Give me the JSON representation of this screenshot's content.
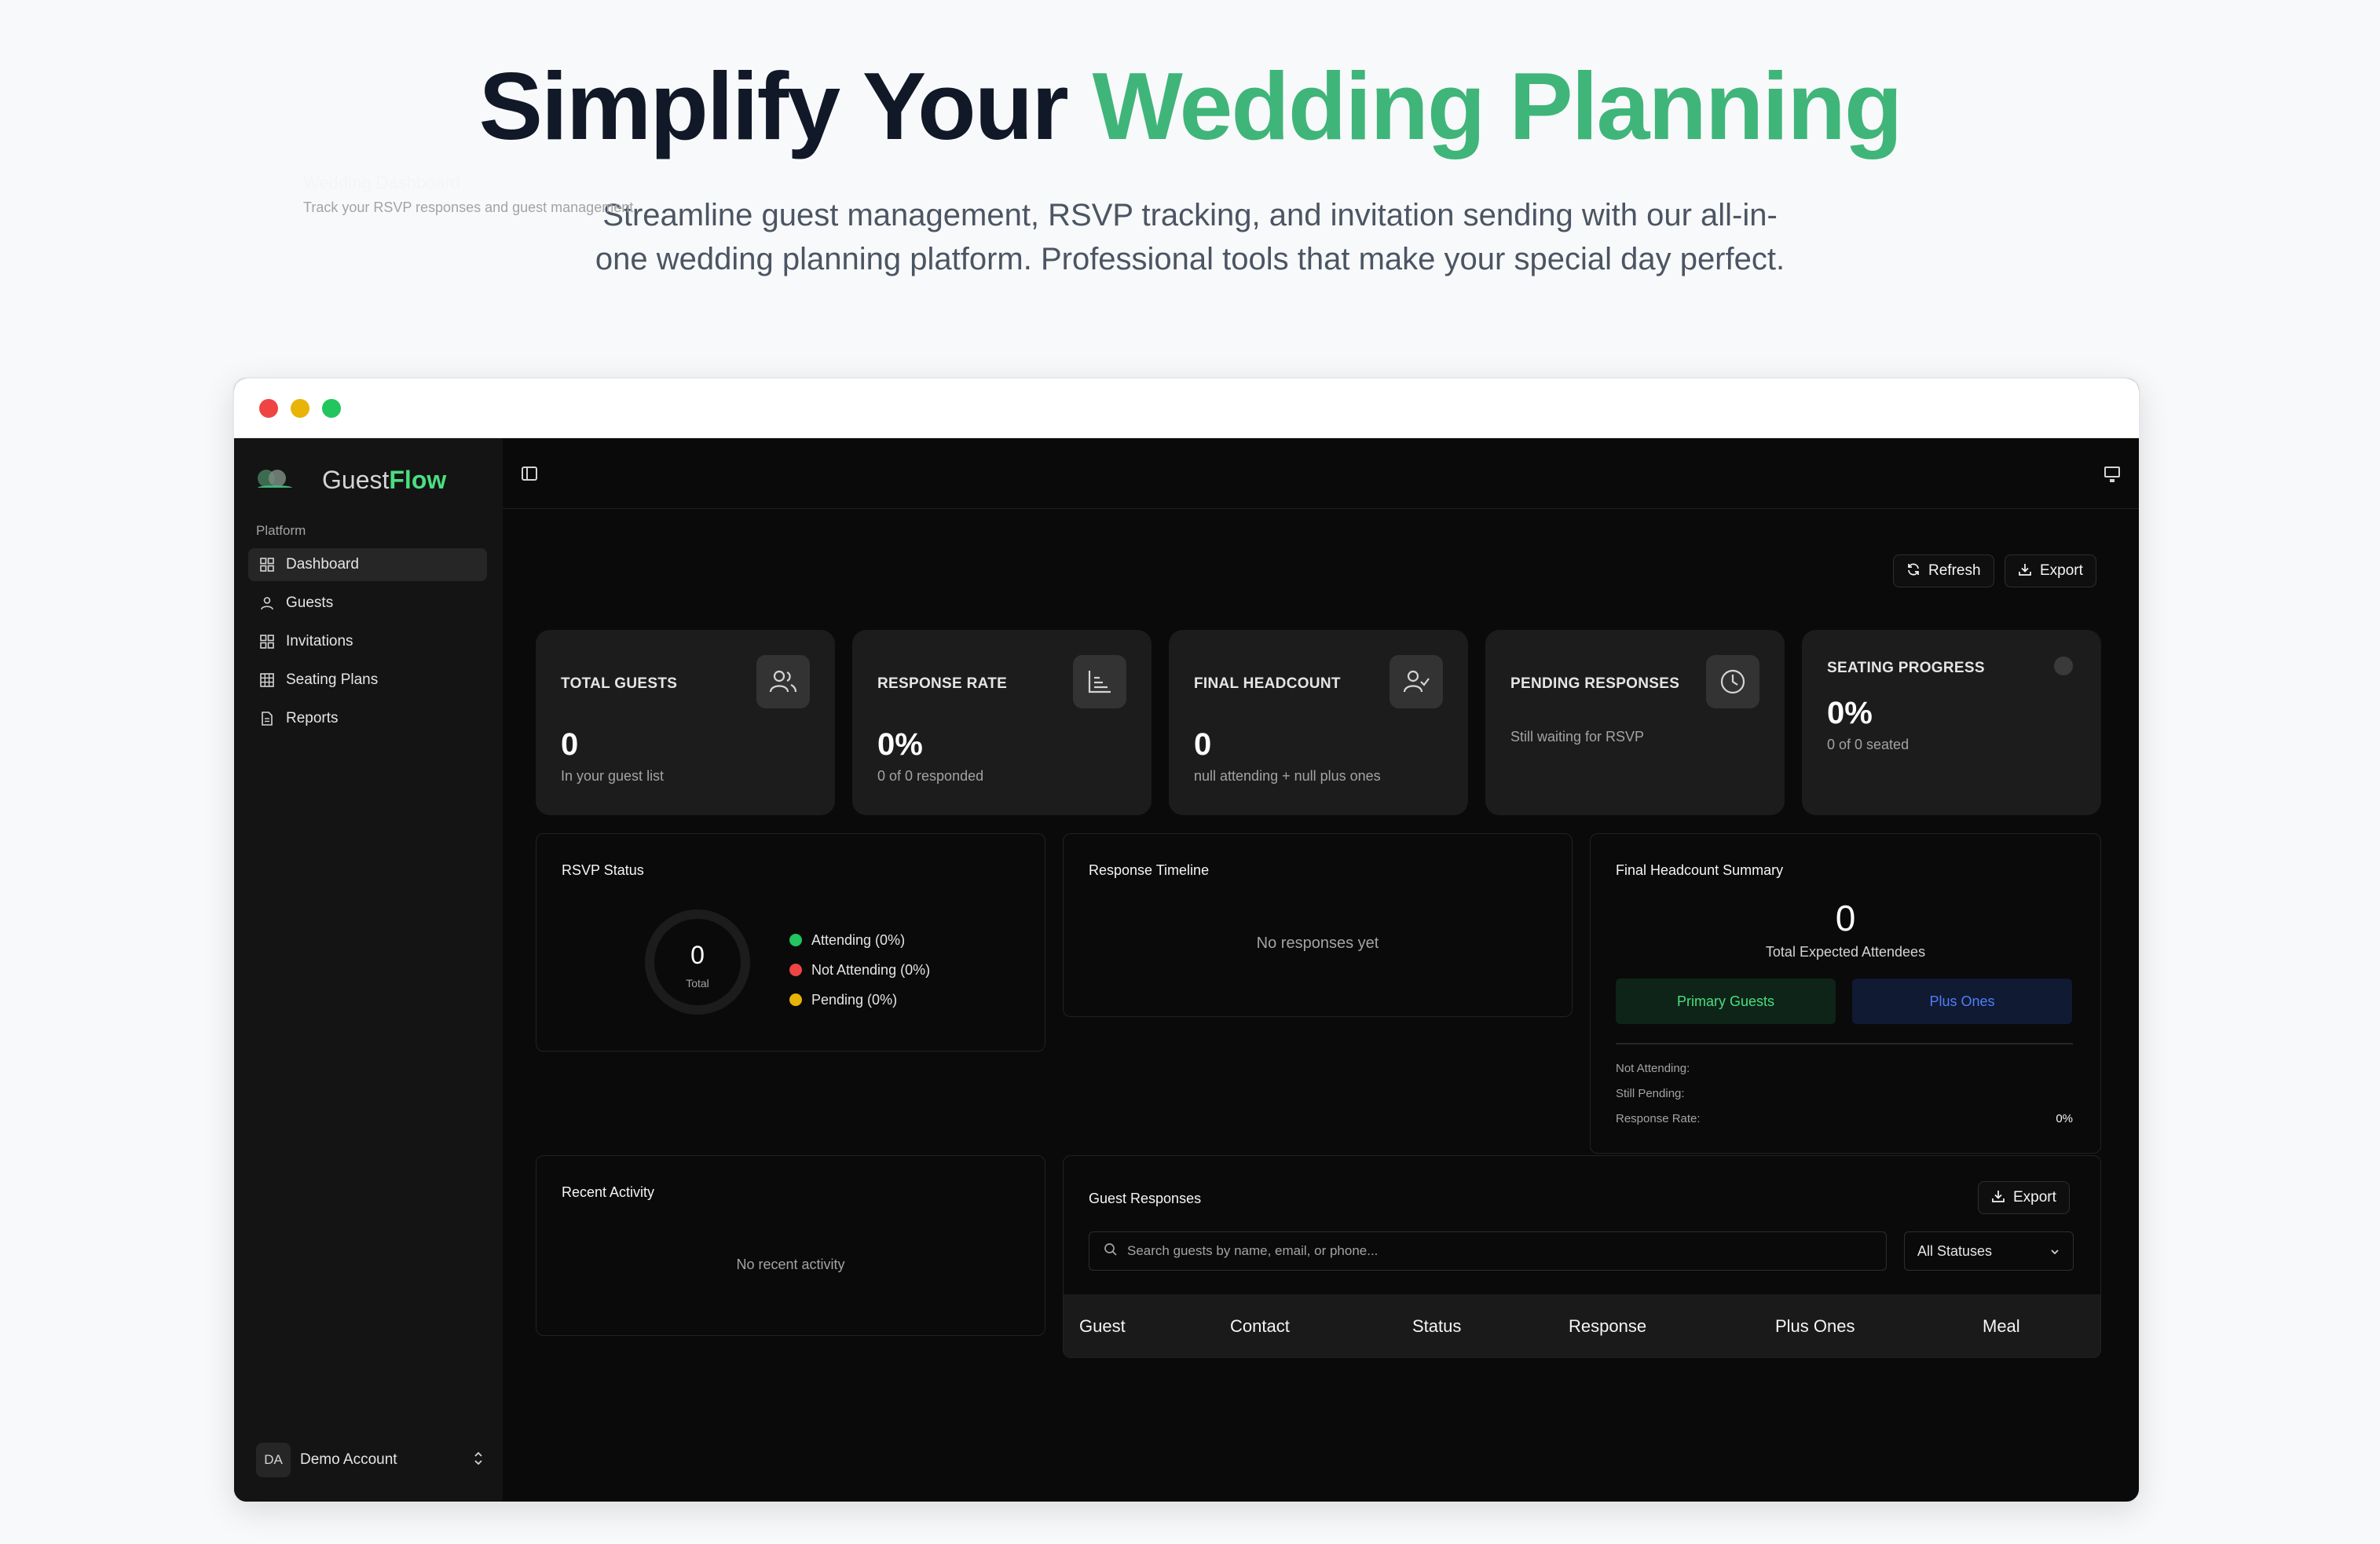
{
  "hero": {
    "title_part1": "Simplify Your ",
    "title_accent": "Wedding Planning",
    "subtitle": "Streamline guest management, RSVP tracking, and invitation sending with our all-in-one wedding planning platform. Professional tools that make your special day perfect."
  },
  "brand": {
    "name_part1": "Guest",
    "name_part2": "Flow"
  },
  "sidebar": {
    "section_label": "Platform",
    "items": [
      {
        "label": "Dashboard",
        "icon": "grid-icon"
      },
      {
        "label": "Guests",
        "icon": "user-icon"
      },
      {
        "label": "Invitations",
        "icon": "grid-icon"
      },
      {
        "label": "Seating Plans",
        "icon": "table-icon"
      },
      {
        "label": "Reports",
        "icon": "document-icon"
      }
    ],
    "account": {
      "initials": "DA",
      "name": "Demo Account"
    }
  },
  "header": {
    "title": "Wedding Dashboard",
    "subtitle": "Track your RSVP responses and guest management",
    "refresh_label": "Refresh",
    "export_label": "Export"
  },
  "stats": [
    {
      "label": "TOTAL GUESTS",
      "value": "0",
      "note": "In your guest list",
      "icon": "users-icon"
    },
    {
      "label": "RESPONSE RATE",
      "value": "0%",
      "note": "0 of 0 responded",
      "icon": "chart-icon"
    },
    {
      "label": "FINAL HEADCOUNT",
      "value": "0",
      "note": "null attending + null plus ones",
      "icon": "user-check-icon"
    },
    {
      "label": "PENDING RESPONSES",
      "value": "",
      "note": "Still waiting for RSVP",
      "icon": "clock-icon"
    },
    {
      "label": "SEATING PROGRESS",
      "value": "0%",
      "note": "0 of 0 seated",
      "icon": "circle-icon"
    }
  ],
  "rsvp": {
    "title": "RSVP Status",
    "total_value": "0",
    "total_label": "Total",
    "legend": [
      {
        "label": "Attending (0%)",
        "color": "#22c55e"
      },
      {
        "label": "Not Attending (0%)",
        "color": "#ef4444"
      },
      {
        "label": "Pending (0%)",
        "color": "#eab308"
      }
    ]
  },
  "timeline": {
    "title": "Response Timeline",
    "empty": "No responses yet"
  },
  "headcount": {
    "title": "Final Headcount Summary",
    "value": "0",
    "value_label": "Total Expected Attendees",
    "primary_label": "Primary Guests",
    "plus_label": "Plus Ones",
    "rows": [
      {
        "label": "Not Attending:",
        "value": ""
      },
      {
        "label": "Still Pending:",
        "value": ""
      },
      {
        "label": "Response Rate:",
        "value": "0%"
      }
    ]
  },
  "activity": {
    "title": "Recent Activity",
    "empty": "No recent activity"
  },
  "responses": {
    "title": "Guest Responses",
    "export_label": "Export",
    "search_placeholder": "Search guests by name, email, or phone...",
    "status_filter": "All Statuses",
    "columns": [
      "Guest",
      "Contact",
      "Status",
      "Response",
      "Plus Ones",
      "Meal"
    ]
  }
}
